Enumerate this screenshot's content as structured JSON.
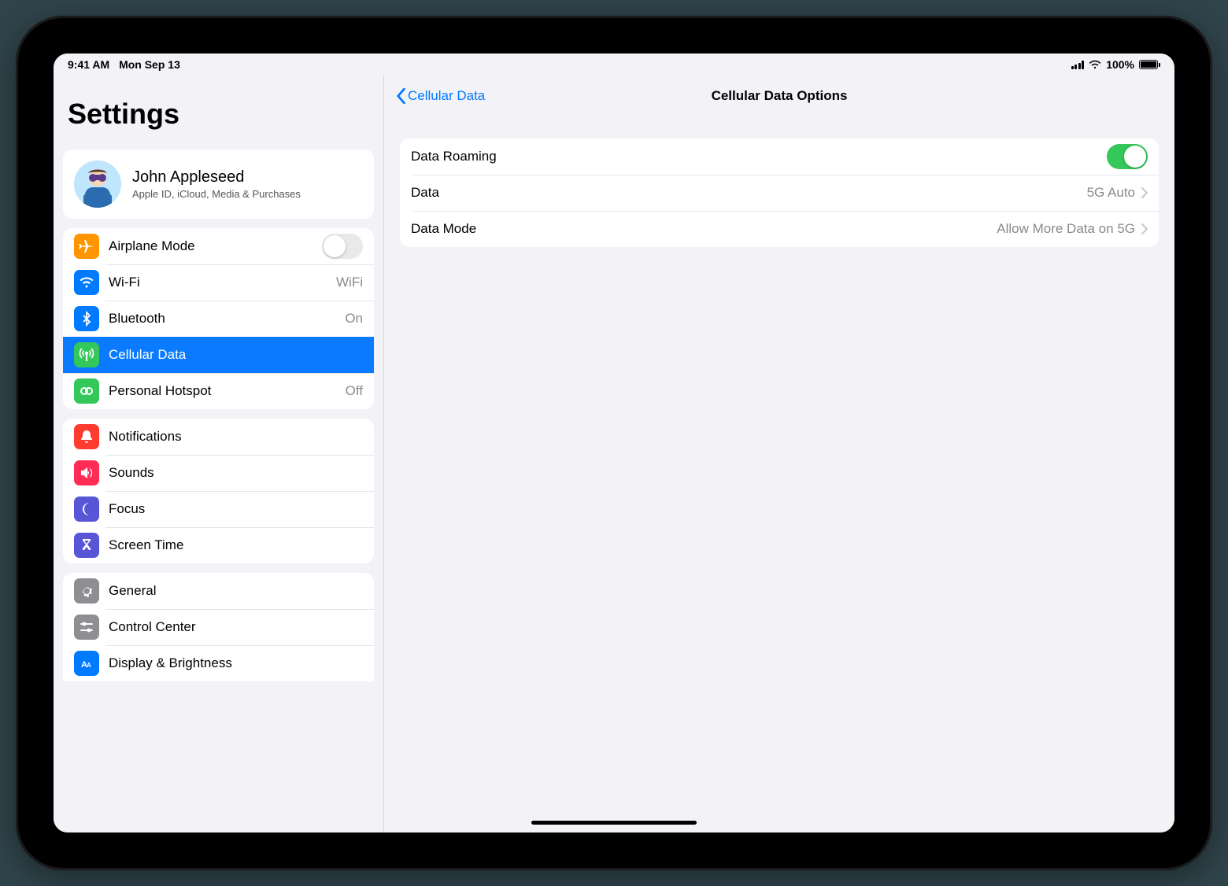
{
  "statusbar": {
    "time": "9:41 AM",
    "date": "Mon Sep 13",
    "battery": "100%"
  },
  "sidebar": {
    "title": "Settings",
    "account": {
      "name": "John Appleseed",
      "subtitle": "Apple ID, iCloud, Media & Purchases"
    },
    "group1": {
      "airplane": "Airplane Mode",
      "wifi": "Wi-Fi",
      "wifi_value": "WiFi",
      "bluetooth": "Bluetooth",
      "bluetooth_value": "On",
      "cellular": "Cellular Data",
      "hotspot": "Personal Hotspot",
      "hotspot_value": "Off"
    },
    "group2": {
      "notifications": "Notifications",
      "sounds": "Sounds",
      "focus": "Focus",
      "screentime": "Screen Time"
    },
    "group3": {
      "general": "General",
      "controlcenter": "Control Center",
      "display": "Display & Brightness"
    }
  },
  "detail": {
    "back": "Cellular Data",
    "title": "Cellular Data Options",
    "rows": {
      "roaming": "Data Roaming",
      "data": "Data",
      "data_value": "5G Auto",
      "mode": "Data Mode",
      "mode_value": "Allow More Data on 5G"
    }
  }
}
